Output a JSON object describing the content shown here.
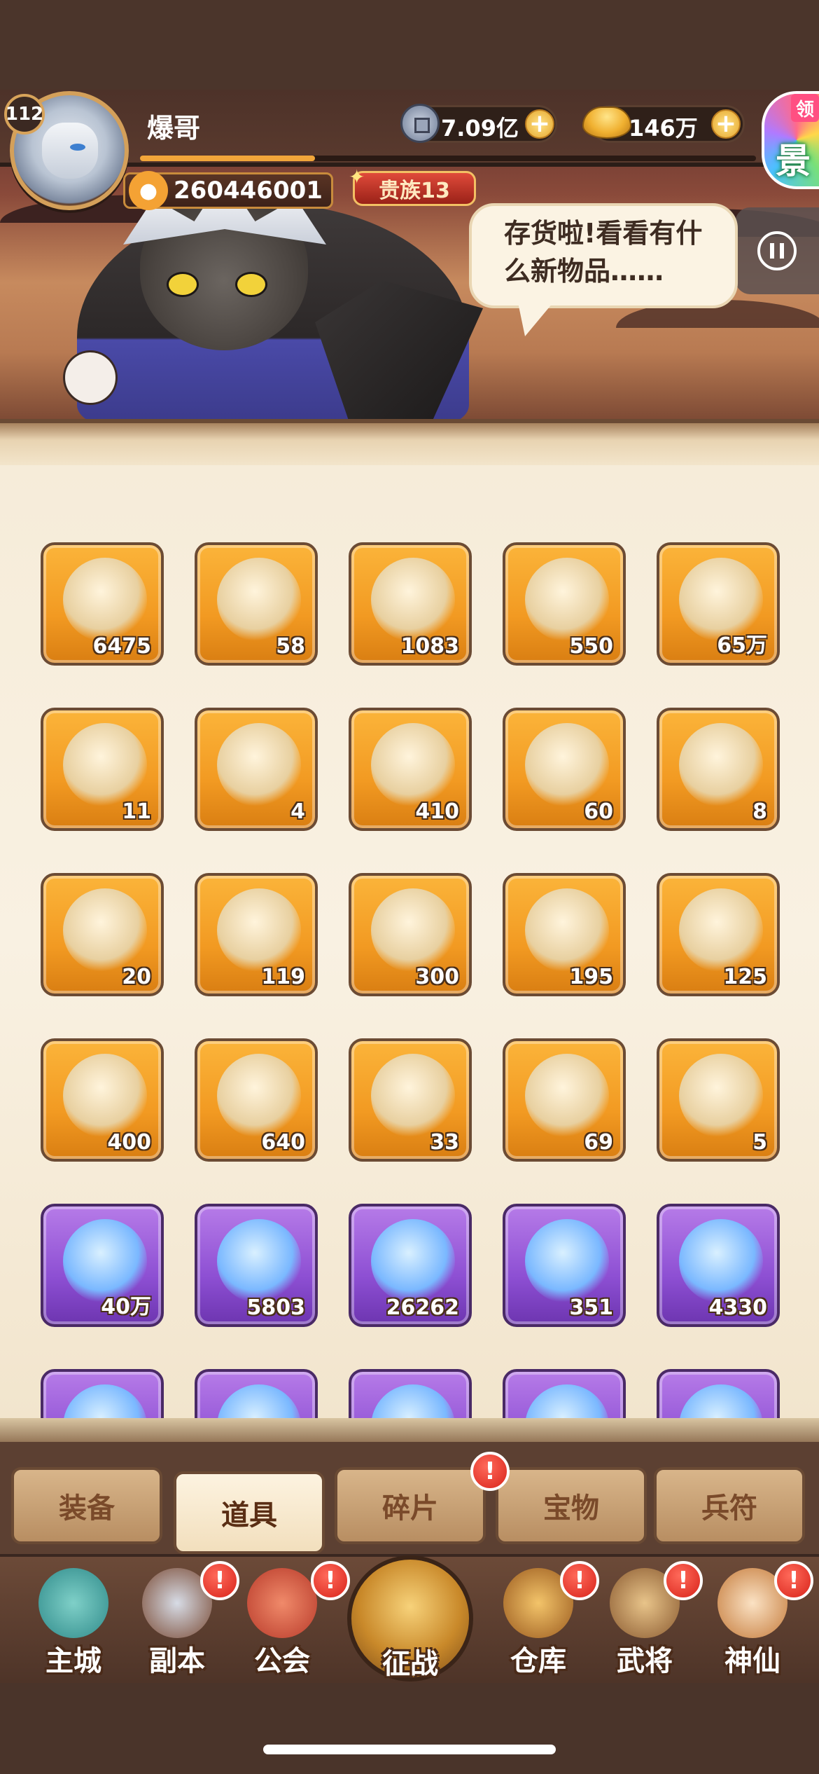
{
  "player": {
    "level": "112",
    "name": "爆哥",
    "id": "260446001",
    "noble": "贵族13"
  },
  "currencies": {
    "coins": "7.09亿",
    "ingots": "146万"
  },
  "gift": {
    "label": "领",
    "char": "景"
  },
  "npc_speech": "存货啦!看看有什么新物品……",
  "items": [
    {
      "name": "scroll-icon",
      "count": "6475",
      "tier": "gold"
    },
    {
      "name": "white-lotus-icon",
      "count": "58",
      "tier": "gold"
    },
    {
      "name": "red-general-token-icon",
      "count": "1083",
      "tier": "gold"
    },
    {
      "name": "purple-general-token-icon",
      "count": "550",
      "tier": "gold"
    },
    {
      "name": "dark-stone-icon",
      "count": "65万",
      "tier": "gold"
    },
    {
      "name": "golden-chest-icon",
      "count": "11",
      "tier": "gold"
    },
    {
      "name": "crystal-chest-icon",
      "count": "4",
      "tier": "gold"
    },
    {
      "name": "crescent-moon-icon",
      "count": "410",
      "tier": "gold"
    },
    {
      "name": "gold-ore-icon",
      "count": "60",
      "tier": "gold"
    },
    {
      "name": "red-gem-icon",
      "count": "8",
      "tier": "gold"
    },
    {
      "name": "iron-hook-icon",
      "count": "20",
      "tier": "gold"
    },
    {
      "name": "amber-stone-icon",
      "count": "119",
      "tier": "gold"
    },
    {
      "name": "party-popper-icon",
      "count": "300",
      "tier": "gold"
    },
    {
      "name": "hero-shard-general-icon",
      "count": "195",
      "tier": "gold"
    },
    {
      "name": "hero-shard-elder-icon",
      "count": "125",
      "tier": "gold"
    },
    {
      "name": "hero-shard-shouting-icon",
      "count": "400",
      "tier": "gold"
    },
    {
      "name": "hero-shard-warrior-icon",
      "count": "640",
      "tier": "gold"
    },
    {
      "name": "orange-orb-dragon-icon",
      "count": "33",
      "tier": "gold"
    },
    {
      "name": "orange-orb-phoenix-icon",
      "count": "69",
      "tier": "gold"
    },
    {
      "name": "orange-orb-tiger-icon",
      "count": "5",
      "tier": "gold"
    },
    {
      "name": "blue-leaf-orb-icon",
      "count": "40万",
      "tier": "purple"
    },
    {
      "name": "purple-scroll-icon",
      "count": "5803",
      "tier": "purple"
    },
    {
      "name": "blue-flame-orb-icon",
      "count": "26262",
      "tier": "purple"
    },
    {
      "name": "pink-lotus-icon",
      "count": "351",
      "tier": "purple"
    },
    {
      "name": "white-egg-icon",
      "count": "4330",
      "tier": "purple"
    },
    {
      "name": "partial-item-icon",
      "count": "",
      "tier": "purple"
    },
    {
      "name": "partial-item-icon",
      "count": "",
      "tier": "purple"
    },
    {
      "name": "partial-item-icon",
      "count": "",
      "tier": "purple"
    },
    {
      "name": "partial-item-icon",
      "count": "",
      "tier": "purple"
    },
    {
      "name": "partial-item-icon",
      "count": "",
      "tier": "purple"
    }
  ],
  "tabs": [
    {
      "label": "装备",
      "active": false
    },
    {
      "label": "道具",
      "active": true
    },
    {
      "label": "碎片",
      "active": false
    },
    {
      "label": "宝物",
      "active": false
    },
    {
      "label": "兵符",
      "active": false
    }
  ],
  "nav": [
    {
      "label": "主城"
    },
    {
      "label": "副本"
    },
    {
      "label": "公会"
    },
    {
      "label": "征战"
    },
    {
      "label": "仓库"
    },
    {
      "label": "武将"
    },
    {
      "label": "神仙"
    }
  ],
  "alert_glyph": "!",
  "colors": {
    "gold_tile": "#f29a22",
    "purple_tile": "#8d4fd3",
    "alert": "#d8231a",
    "panel_bg": "#f6ecd9"
  }
}
